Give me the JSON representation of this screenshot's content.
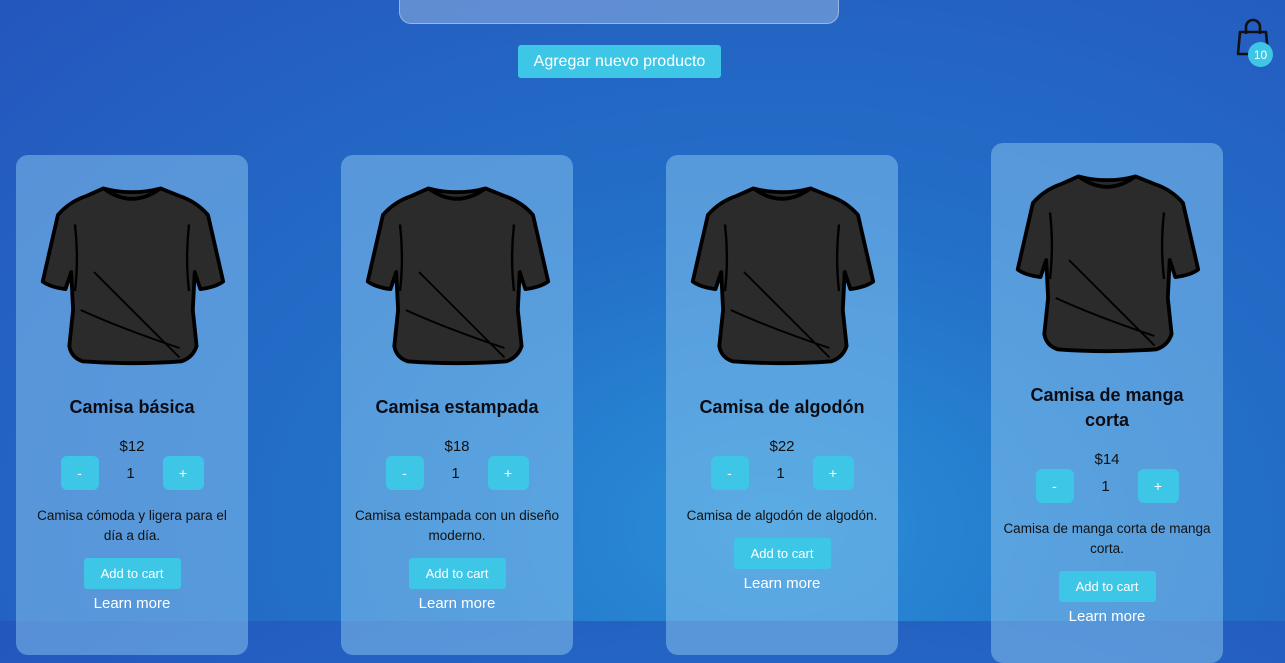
{
  "header": {
    "add_product_label": "Agregar nuevo producto",
    "cart_icon": "shopping-bag-icon",
    "cart_count": "10"
  },
  "colors": {
    "accent": "#3ec6e6",
    "shirt": "#2b2b2b"
  },
  "products": [
    {
      "title": "Camisa básica",
      "price": "$12",
      "quantity": "1",
      "minus": "-",
      "plus": "+",
      "description": "Camisa cómoda y ligera para el día a día.",
      "add_to_cart": "Add to cart",
      "learn_more": "Learn more"
    },
    {
      "title": "Camisa estampada",
      "price": "$18",
      "quantity": "1",
      "minus": "-",
      "plus": "+",
      "description": "Camisa estampada con un diseño moderno.",
      "add_to_cart": "Add to cart",
      "learn_more": "Learn more"
    },
    {
      "title": "Camisa de algodón",
      "price": "$22",
      "quantity": "1",
      "minus": "-",
      "plus": "+",
      "description": "Camisa de algodón de algodón.",
      "add_to_cart": "Add to cart",
      "learn_more": "Learn more"
    },
    {
      "title": "Camisa de manga corta",
      "price": "$14",
      "quantity": "1",
      "minus": "-",
      "plus": "+",
      "description": "Camisa de manga corta de manga corta.",
      "add_to_cart": "Add to cart",
      "learn_more": "Learn more"
    }
  ]
}
